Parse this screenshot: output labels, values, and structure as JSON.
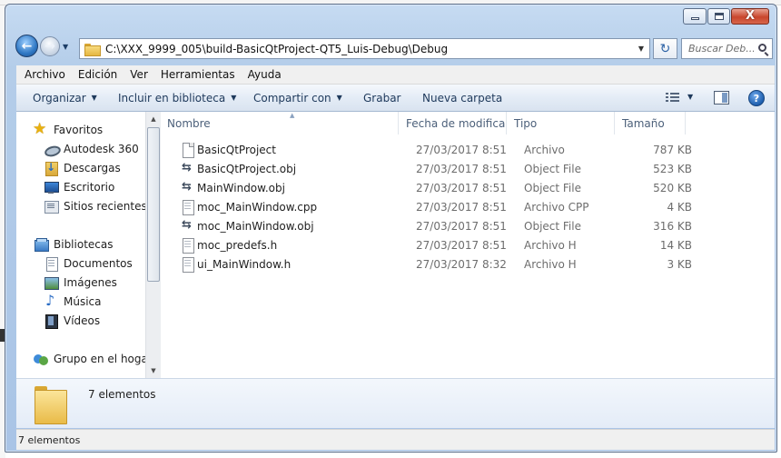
{
  "window": {
    "controls": {
      "minimize": "minimize",
      "maximize": "maximize",
      "close": "X"
    }
  },
  "address_bar": {
    "path": "C:\\XXX_9999_005\\build-BasicQtProject-QT5_Luis-Debug\\Debug"
  },
  "search": {
    "placeholder": "Buscar Deb..."
  },
  "menu": [
    "Archivo",
    "Edición",
    "Ver",
    "Herramientas",
    "Ayuda"
  ],
  "toolbar": {
    "organizar": "Organizar",
    "incluir": "Incluir en biblioteca",
    "compartir": "Compartir con",
    "grabar": "Grabar",
    "nueva_carpeta": "Nueva carpeta"
  },
  "nav_pane": {
    "favorites_header": "Favoritos",
    "favorites": [
      "Autodesk 360",
      "Descargas",
      "Escritorio",
      "Sitios recientes"
    ],
    "libraries_header": "Bibliotecas",
    "libraries": [
      "Documentos",
      "Imágenes",
      "Música",
      "Vídeos"
    ],
    "homegroup": "Grupo en el hogar"
  },
  "columns": {
    "name": "Nombre",
    "date": "Fecha de modifica...",
    "type": "Tipo",
    "size": "Tamaño"
  },
  "files": [
    {
      "name": "BasicQtProject",
      "date": "27/03/2017 8:51",
      "type": "Archivo",
      "size": "787 KB",
      "icon": "file-icon"
    },
    {
      "name": "BasicQtProject.obj",
      "date": "27/03/2017 8:51",
      "type": "Object File",
      "size": "523 KB",
      "icon": "object-file-icon"
    },
    {
      "name": "MainWindow.obj",
      "date": "27/03/2017 8:51",
      "type": "Object File",
      "size": "520 KB",
      "icon": "object-file-icon"
    },
    {
      "name": "moc_MainWindow.cpp",
      "date": "27/03/2017 8:51",
      "type": "Archivo CPP",
      "size": "4 KB",
      "icon": "text-file-icon"
    },
    {
      "name": "moc_MainWindow.obj",
      "date": "27/03/2017 8:51",
      "type": "Object File",
      "size": "316 KB",
      "icon": "object-file-icon"
    },
    {
      "name": "moc_predefs.h",
      "date": "27/03/2017 8:51",
      "type": "Archivo H",
      "size": "14 KB",
      "icon": "text-file-icon"
    },
    {
      "name": "ui_MainWindow.h",
      "date": "27/03/2017 8:32",
      "type": "Archivo H",
      "size": "3 KB",
      "icon": "text-file-icon"
    }
  ],
  "details_pane": {
    "count_text": "7 elementos"
  },
  "status_bar": {
    "count_text": "7 elementos"
  },
  "colors": {
    "frame": "#b4cde9",
    "command_bar": "#e4ecf6",
    "header_text": "#4c607a",
    "secondary_text": "#6d6d6d"
  }
}
